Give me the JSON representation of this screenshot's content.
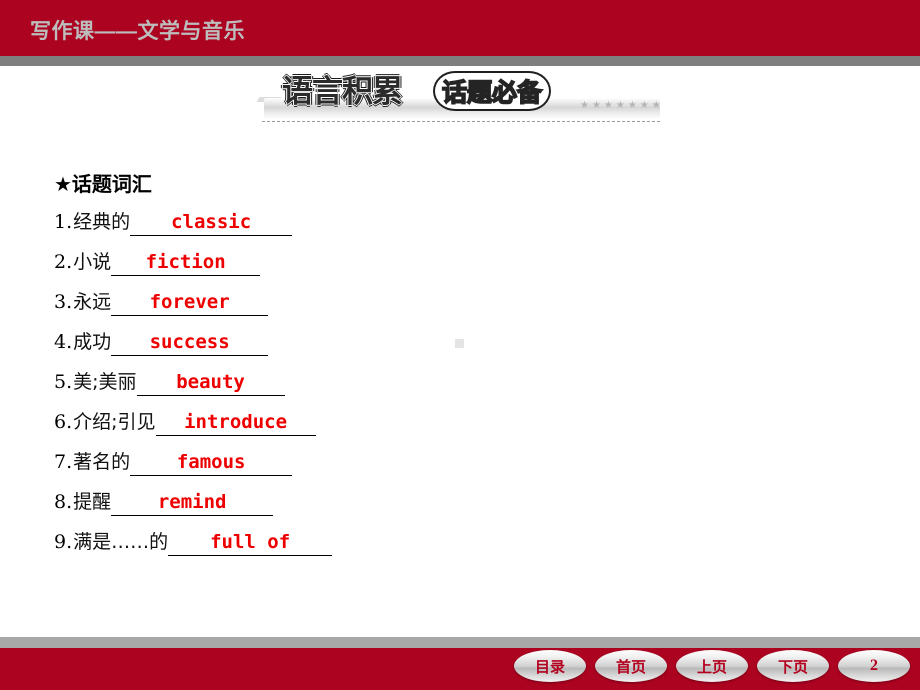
{
  "top_banner": {
    "title": "写作课——文学与音乐",
    "bg_color": "#ac0320",
    "title_color": "#bdbdbd"
  },
  "section_header": {
    "title": "语言积累",
    "badge": "话题必备",
    "stars": "★★★★★★★",
    "accent_color": "#2b2b2b"
  },
  "main": {
    "topic_heading": "★话题词汇",
    "answer_color": "#ee0000",
    "items": [
      {
        "num": "1.",
        "cn": "经典的 ",
        "answer": "classic",
        "blank_width": "150"
      },
      {
        "num": "2.",
        "cn": "小说",
        "answer": "fiction",
        "blank_width": "137"
      },
      {
        "num": "3.",
        "cn": "永远 ",
        "answer": "forever",
        "blank_width": "145"
      },
      {
        "num": "4.",
        "cn": "成功 ",
        "answer": "success",
        "blank_width": "145"
      },
      {
        "num": "5.",
        "cn": "美;美丽",
        "answer": "beauty",
        "blank_width": "136"
      },
      {
        "num": "6.",
        "cn": "介绍;引见 ",
        "answer": "introduce",
        "blank_width": "148"
      },
      {
        "num": "7.",
        "cn": "著名的 ",
        "answer": "famous",
        "blank_width": "150"
      },
      {
        "num": "8.",
        "cn": "提醒",
        "answer": "remind",
        "blank_width": "150"
      },
      {
        "num": "9.",
        "cn": "满是……的 ",
        "answer": "full of",
        "blank_width": "152"
      }
    ]
  },
  "bottom_bar": {
    "bg_color": "#ac0320",
    "buttons": [
      {
        "label": "目录"
      },
      {
        "label": "首页"
      },
      {
        "label": "上页"
      },
      {
        "label": "下页"
      },
      {
        "label": "2"
      }
    ]
  }
}
